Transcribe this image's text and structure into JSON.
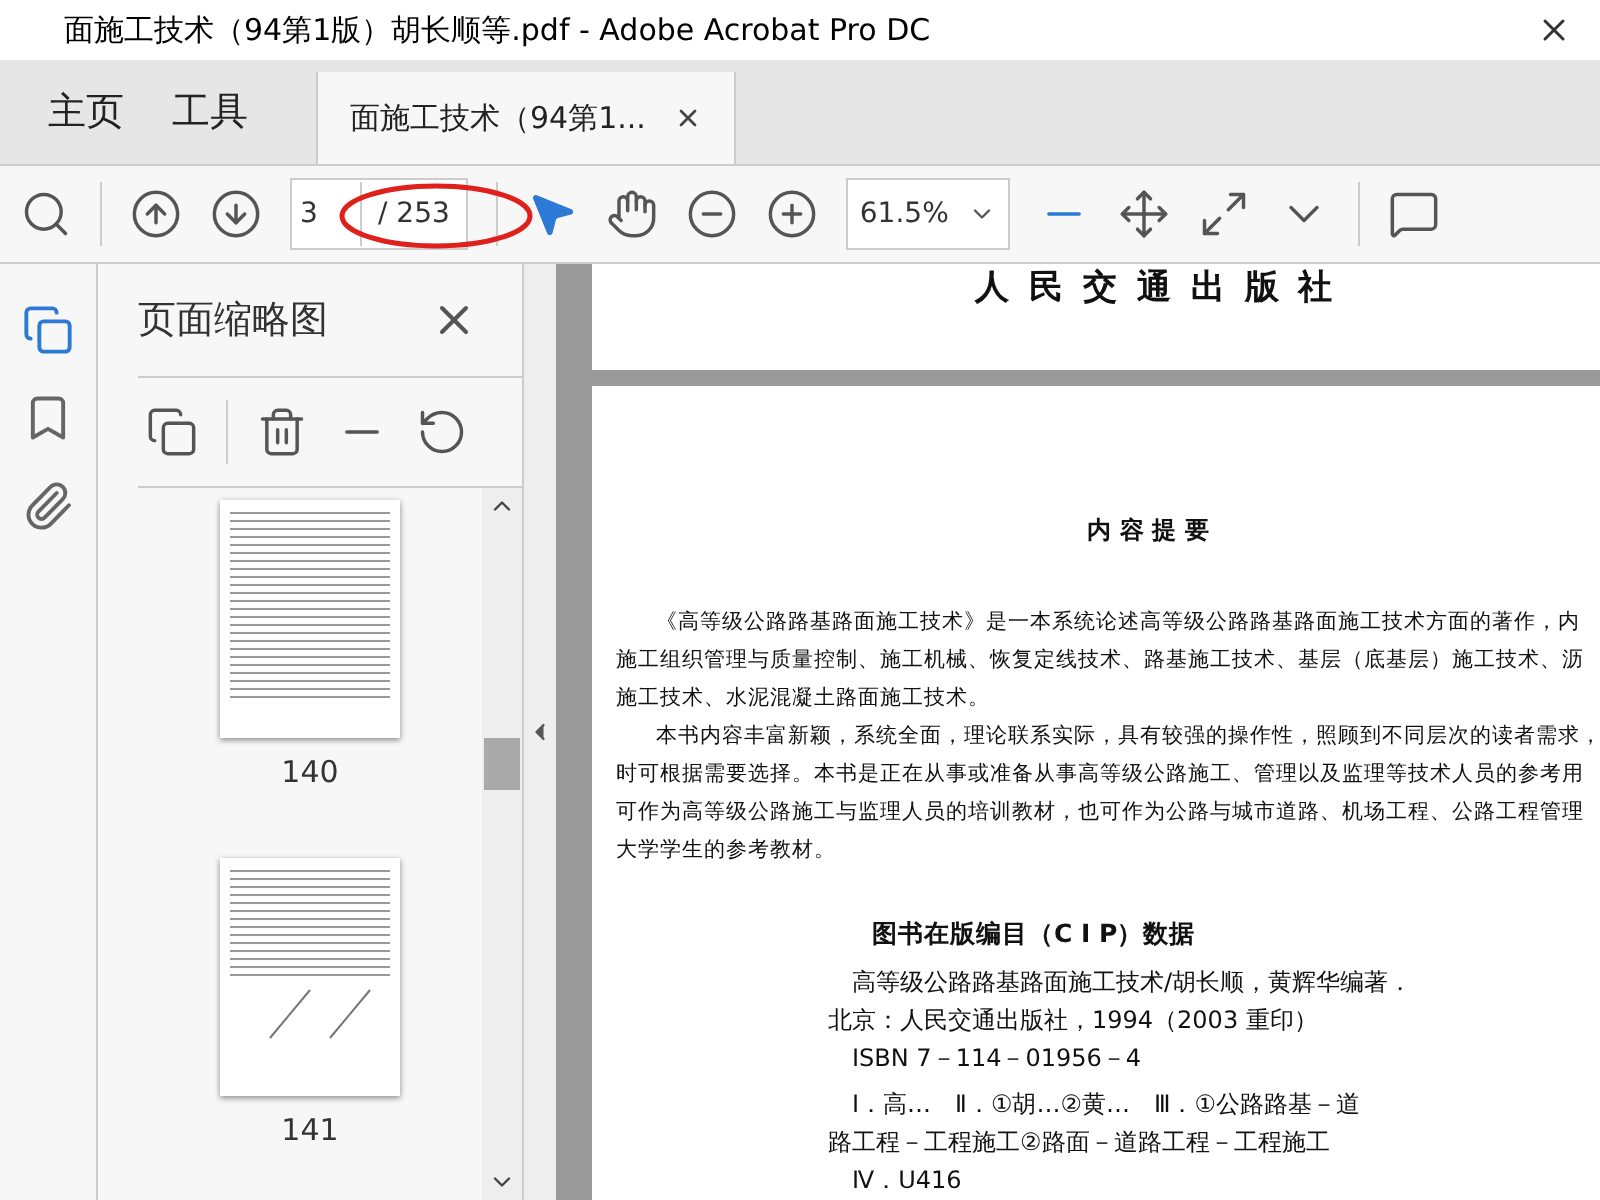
{
  "window": {
    "title": "面施工技术（94第1版）胡长顺等.pdf - Adobe Acrobat Pro DC"
  },
  "nav_tabs": [
    {
      "label": "主页",
      "selected": false
    },
    {
      "label": "工具",
      "selected": false
    },
    {
      "label": "面施工技术（94第1...",
      "selected": true
    }
  ],
  "toolbar": {
    "page_input": "3",
    "page_total": "/ 253",
    "zoom": "61.5%"
  },
  "rail": [
    {
      "kind": "pages",
      "selected": true
    },
    {
      "kind": "bookmarks",
      "selected": false
    },
    {
      "kind": "attachments",
      "selected": false
    }
  ],
  "sidebar": {
    "title": "页面缩略图",
    "thumbnails": [
      {
        "label": "140",
        "figures": false
      },
      {
        "label": "141",
        "figures": true
      }
    ]
  },
  "document": {
    "publisher": "人 民 交 通 出 版 社",
    "heading": "内 容 提 要",
    "paragraphs": [
      [
        "《高等级公路路基路面施工技术》是一本系统论述高等级公路路基路面施工技术方面的著作，内",
        "施工组织管理与质量控制、施工机械、恢复定线技术、路基施工技术、基层（底基层）施工技术、沥",
        "施工技术、水泥混凝土路面施工技术。"
      ],
      [
        "本书内容丰富新颖，系统全面，理论联系实际，具有较强的操作性，照顾到不同层次的读者需求，",
        "时可根据需要选择。本书是正在从事或准备从事高等级公路施工、管理以及监理等技术人员的参考用",
        "可作为高等级公路施工与监理人员的培训教材，也可作为公路与城市道路、机场工程、公路工程管理",
        "大学学生的参考教材。"
      ]
    ],
    "cip_title": "图书在版编目（C I P）数据",
    "cip_lines": [
      "高等级公路路基路面施工技术/胡长顺，黄辉华编著．",
      "北京：人民交通出版社，1994（2003 重印）",
      "ISBN 7－114－01956－4",
      "Ⅰ．高…　Ⅱ．①胡…②黄…　Ⅲ．①公路路基－道",
      "路工程－工程施工②路面－道路工程－工程施工",
      "Ⅳ．U416"
    ]
  }
}
